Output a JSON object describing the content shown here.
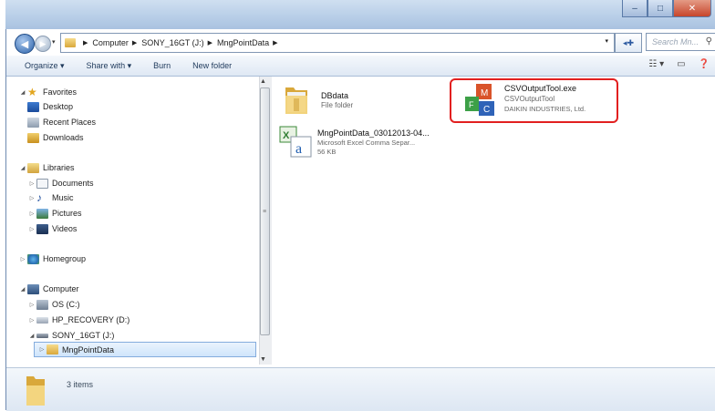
{
  "address": {
    "crumbs": [
      "Computer",
      "SONY_16GT (J:)",
      "MngPointData"
    ],
    "search_placeholder": "Search Mn..."
  },
  "toolbar": {
    "organize": "Organize ▾",
    "share_with": "Share with ▾",
    "burn": "Burn",
    "new_folder": "New folder"
  },
  "nav": {
    "favorites": "Favorites",
    "desktop": "Desktop",
    "recent_places": "Recent Places",
    "downloads": "Downloads",
    "libraries": "Libraries",
    "documents": "Documents",
    "music": "Music",
    "pictures": "Pictures",
    "videos": "Videos",
    "homegroup": "Homegroup",
    "computer": "Computer",
    "os": "OS (C:)",
    "hp_recovery": "HP_RECOVERY (D:)",
    "sony": "SONY_16GT (J:)",
    "mngpointdata": "MngPointData"
  },
  "files": [
    {
      "name": "DBdata",
      "line2": "File folder",
      "line3": ""
    },
    {
      "name": "CSVOutputTool.exe",
      "line2": "CSVOutputTool",
      "line3": "DAIKIN INDUSTRIES, Ltd."
    },
    {
      "name": "MngPointData_03012013-04...",
      "line2": "Microsoft Excel Comma Separ...",
      "line3": "56 KB"
    }
  ],
  "status": {
    "item_count": "3 items"
  },
  "colors": {
    "highlight": "#e22020",
    "selection": "#cfe5fb"
  }
}
